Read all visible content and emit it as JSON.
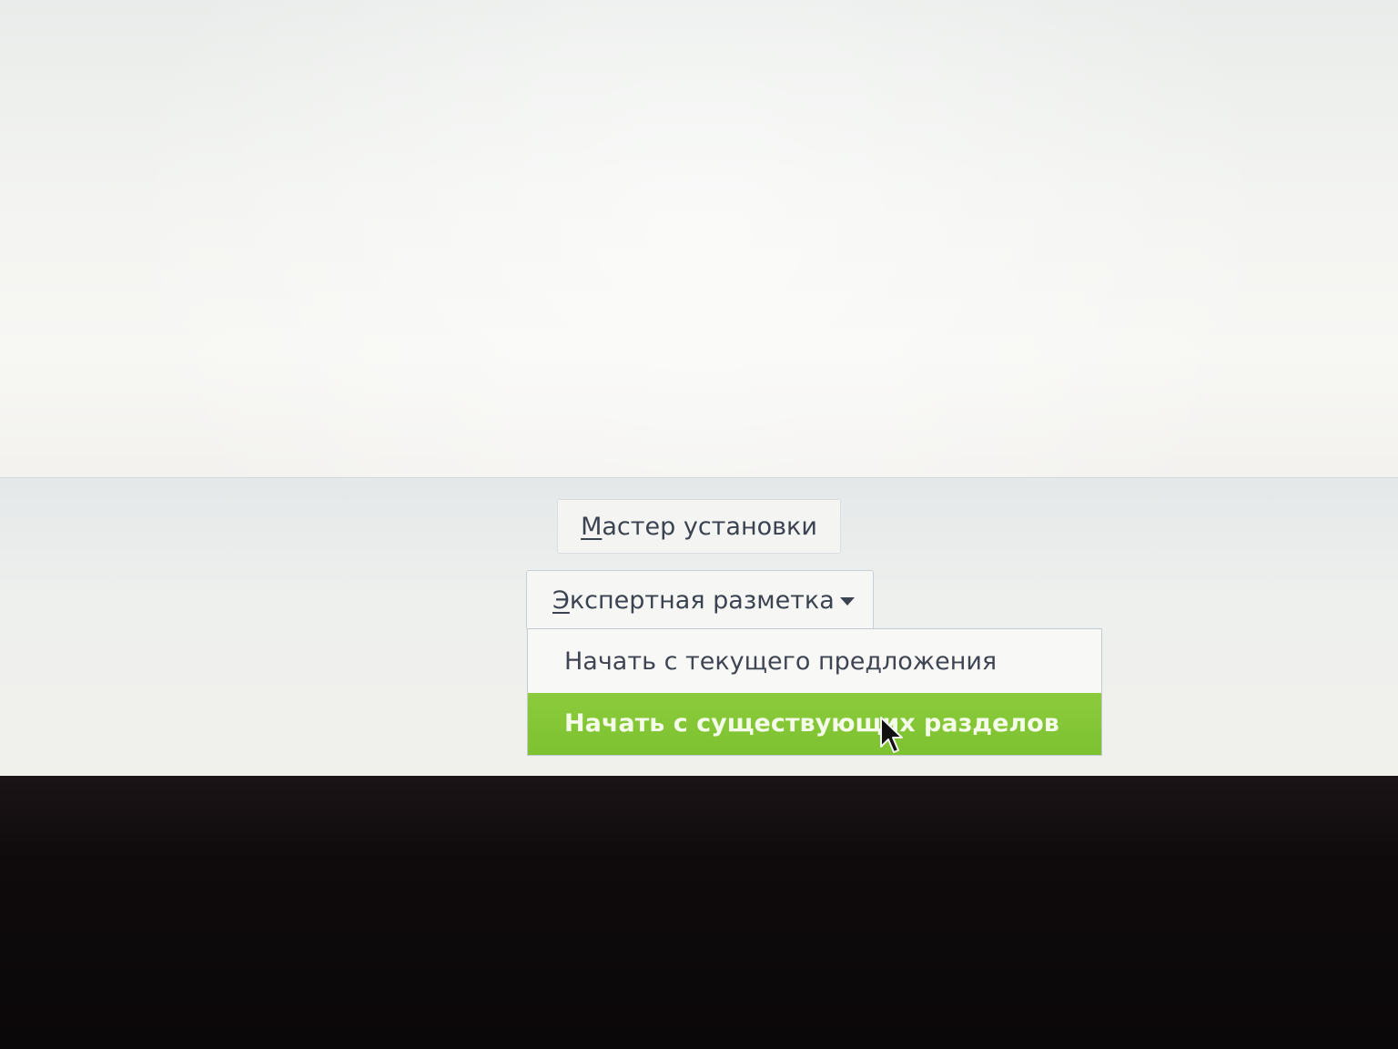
{
  "buttons": {
    "wizard": {
      "mnemonic": "М",
      "rest": "астер установки"
    },
    "expert": {
      "mnemonic": "Э",
      "rest": "кспертная разметка"
    }
  },
  "menu": {
    "items": [
      {
        "label": "Начать с текущего предложения",
        "selected": false
      },
      {
        "label": "Начать с существующих разделов",
        "selected": true
      }
    ]
  },
  "colors": {
    "highlight": "#7dc230",
    "text": "#3b4250",
    "bezel": "#0d0a0c"
  },
  "icons": {
    "dropdown": "chevron-down-icon",
    "cursor": "mouse-pointer-icon"
  }
}
